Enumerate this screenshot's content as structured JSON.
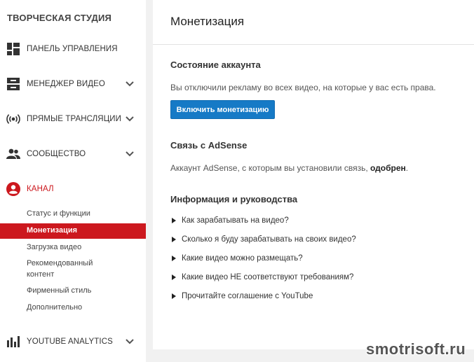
{
  "sidebar": {
    "title": "ТВОРЧЕСКАЯ СТУДИЯ",
    "items": [
      {
        "label": "ПАНЕЛЬ УПРАВЛЕНИЯ",
        "icon": "dashboard-icon"
      },
      {
        "label": "МЕНЕДЖЕР ВИДЕО",
        "icon": "video-manager-icon"
      },
      {
        "label": "ПРЯМЫЕ ТРАНСЛЯЦИИ",
        "icon": "live-broadcast-icon"
      },
      {
        "label": "СООБЩЕСТВО",
        "icon": "community-icon"
      },
      {
        "label": "КАНАЛ",
        "icon": "channel-icon"
      },
      {
        "label": "YOUTUBE ANALYTICS",
        "icon": "analytics-icon"
      }
    ],
    "channel_subitems": [
      "Статус и функции",
      "Монетизация",
      "Загрузка видео",
      "Рекомендованный контент",
      "Фирменный стиль",
      "Дополнительно"
    ]
  },
  "main": {
    "title": "Монетизация",
    "account_status": {
      "heading": "Состояние аккаунта",
      "text": "Вы отключили рекламу во всех видео, на которые у вас есть права.",
      "button": "Включить монетизацию"
    },
    "adsense": {
      "heading": "Связь с AdSense",
      "text_prefix": "Аккаунт AdSense, с которым вы установили связь, ",
      "text_bold": "одобрен",
      "text_suffix": "."
    },
    "info": {
      "heading": "Информация и руководства",
      "links": [
        "Как зарабатывать на видео?",
        "Сколько я буду зарабатывать на своих видео?",
        "Какие видео можно размещать?",
        "Какие видео НЕ соответствуют требованиям?",
        "Прочитайте соглашение с YouTube"
      ]
    }
  },
  "watermark": "smotrisoft.ru",
  "colors": {
    "accent_red": "#cc181e",
    "button_blue": "#167ac6"
  }
}
